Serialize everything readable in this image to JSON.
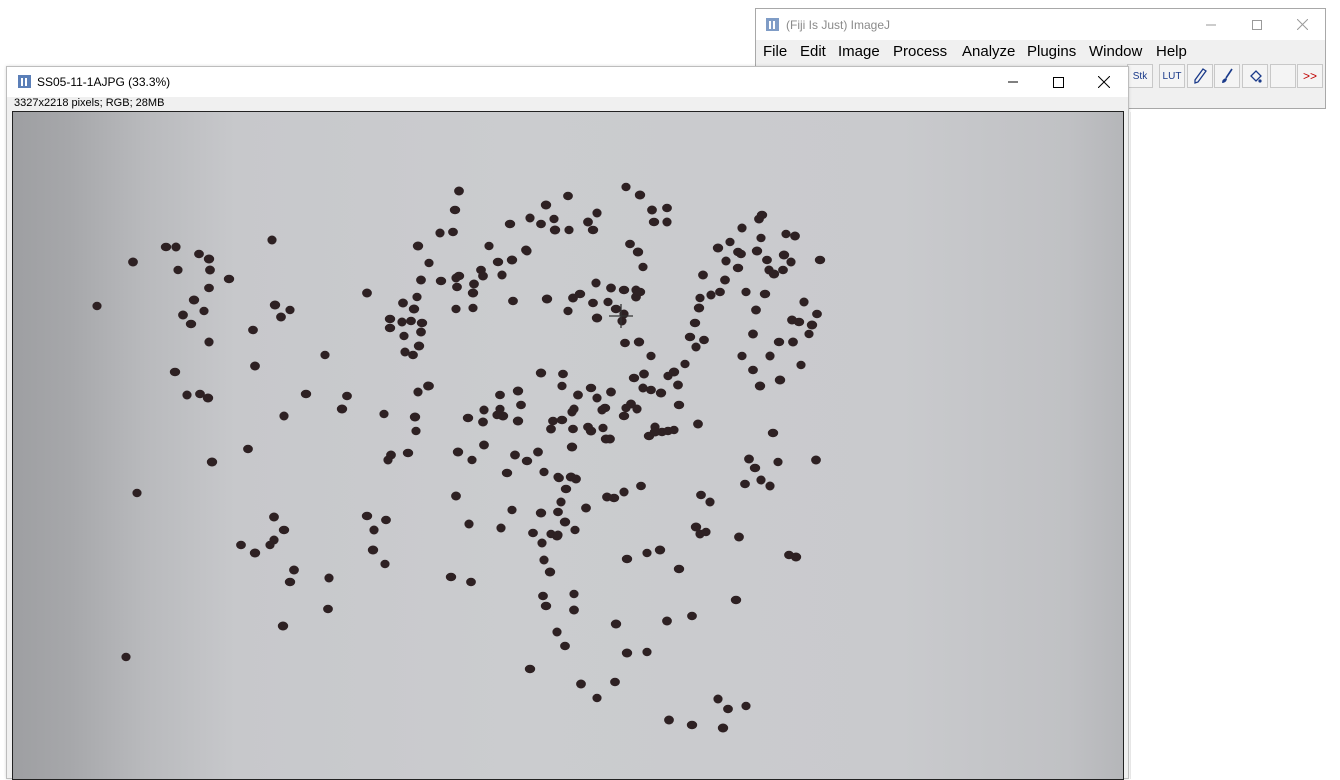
{
  "fiji": {
    "title": "(Fiji Is Just) ImageJ",
    "menu": [
      "File",
      "Edit",
      "Image",
      "Process",
      "Analyze",
      "Plugins",
      "Window",
      "Help"
    ],
    "tools": {
      "stk": "Stk",
      "lut": "LUT",
      "more": ">>"
    }
  },
  "image_window": {
    "title": "SS05-11-1AJPG (33.3%)",
    "info": "3327x2218 pixels; RGB; 28MB"
  },
  "colors": {
    "seed": "#2e2123",
    "accent": "#1a3a8a",
    "more": "#c00000"
  }
}
